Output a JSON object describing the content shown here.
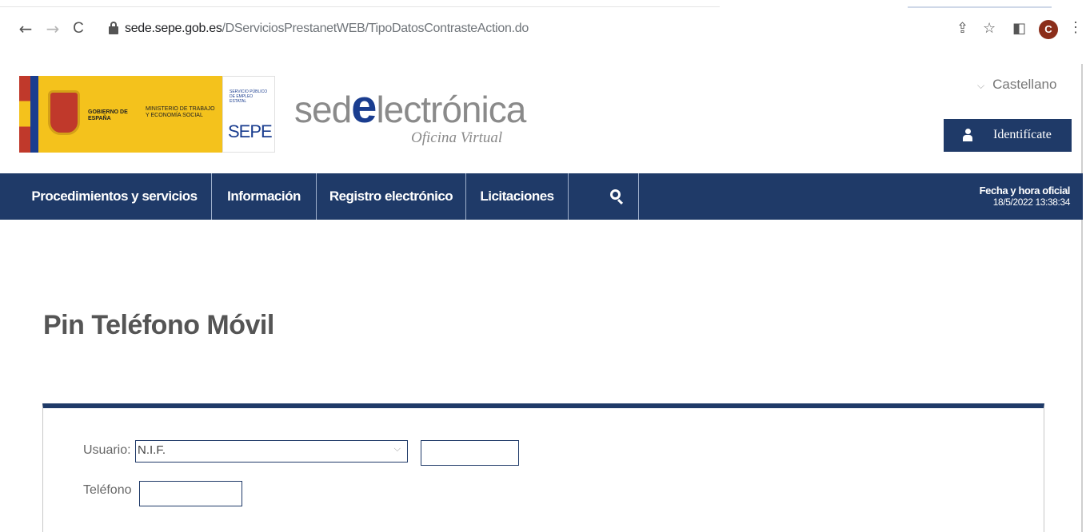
{
  "browser": {
    "back_icon": "←",
    "forward_icon": "→",
    "reload_icon": "C",
    "url_host": "sede.sepe.gob.es",
    "url_path": "/DServiciosPrestanetWEB/TipoDatosContrasteAction.do",
    "share_icon": "⇪",
    "star_icon": "☆",
    "window_icon": "◧",
    "avatar_letter": "C",
    "menu_icon": "⋮"
  },
  "header": {
    "gov_text_1": "GOBIERNO DE ESPAÑA",
    "gov_text_2": "MINISTERIO DE TRABAJO Y ECONOMÍA SOCIAL",
    "sepe_small": "SERVICIO PÚBLICO DE EMPLEO ESTATAL",
    "sepe_big": "SEPE",
    "sede_prefix": "sed",
    "sede_e": "e",
    "sede_suffix": "lectrónica",
    "sede_sub": "Oficina Virtual",
    "language": "Castellano",
    "identify_label": "Identifícate"
  },
  "nav": {
    "items": [
      {
        "label": "Procedimientos y servicios"
      },
      {
        "label": "Información"
      },
      {
        "label": "Registro electrónico"
      },
      {
        "label": "Licitaciones"
      }
    ],
    "datetime_label": "Fecha y hora oficial",
    "datetime_value": "18/5/2022 13:38:34"
  },
  "page": {
    "title": "Pin Teléfono Móvil"
  },
  "form": {
    "usuario_label": "Usuario:",
    "usuario_selected": "N.I.F.",
    "telefono_label": "Teléfono"
  },
  "colors": {
    "navy": "#1f3a68",
    "logo_yellow": "#f4c21c"
  }
}
